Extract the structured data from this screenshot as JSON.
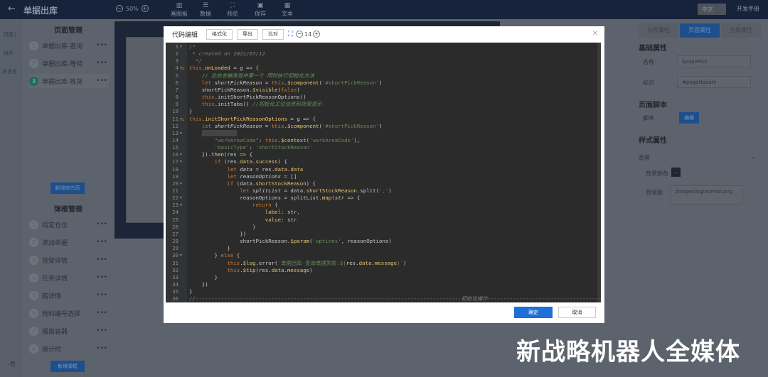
{
  "topbar": {
    "title": "单据出库",
    "zoom": "50%",
    "tools": [
      "画图板",
      "数据",
      "预览",
      "保存",
      "文本"
    ],
    "lang": "中文",
    "manual": "开发手册"
  },
  "rail": [
    "页面",
    "组件",
    "多语言"
  ],
  "sidebar": {
    "pages_title": "页面管理",
    "pages": [
      {
        "n": "1",
        "label": "单据出库-查询"
      },
      {
        "n": "2",
        "label": "单据出库-等待"
      },
      {
        "n": "3",
        "label": "单据出库-拣货"
      }
    ],
    "add_page": "新增空白页",
    "dialogs_title": "弹框管理",
    "dialogs": [
      {
        "n": "1",
        "label": "指定仓位"
      },
      {
        "n": "2",
        "label": "添加单据"
      },
      {
        "n": "3",
        "label": "货架详情"
      },
      {
        "n": "4",
        "label": "任务详情"
      },
      {
        "n": "5",
        "label": "箱详情"
      },
      {
        "n": "6",
        "label": "物料编号选择"
      },
      {
        "n": "7",
        "label": "搬离容器"
      },
      {
        "n": "8",
        "label": "倒计时"
      }
    ],
    "add_dialog": "新增弹框"
  },
  "right": {
    "tabs": [
      "元件属性",
      "页面属性",
      "全局属性"
    ],
    "basic": "基础属性",
    "name_label": "名称",
    "name_value": "$pagePick",
    "id_label": "标识",
    "id_value": "#pageUpdate",
    "script_title": "页面脚本",
    "script_label": "脚本",
    "edit": "编辑",
    "style_title": "样式属性",
    "bg": "背景",
    "bg_color": "背景颜色",
    "bg_img": "背景图",
    "bg_img_value": "/images/bg/normal.png"
  },
  "modal": {
    "title": "代码编辑",
    "format": "格式化",
    "export": "导出",
    "compare": "比对",
    "font_size": "14",
    "ok": "确定",
    "cancel": "取消",
    "lines": [
      {
        "f": 1,
        "t": [
          [
            "cz",
            "/*"
          ]
        ]
      },
      {
        "t": [
          [
            "cz",
            " * created on 2021/07/12"
          ]
        ]
      },
      {
        "t": [
          [
            "cz",
            "  */"
          ]
        ]
      },
      {
        "f": 1,
        "w": 1,
        "t": [
          [
            "kw",
            "this"
          ],
          [
            "",
            "."
          ],
          [
            "fn",
            "onLoaded"
          ],
          [
            "",
            " = g => {"
          ]
        ]
      },
      {
        "t": [
          [
            "cm",
            "    // 此处会触发选中第一个 同时执行初始化方法"
          ]
        ]
      },
      {
        "t": [
          [
            "kw",
            "    let "
          ],
          [
            "it",
            "shortPickReason"
          ],
          [
            "",
            " = "
          ],
          [
            "kw",
            "this"
          ],
          [
            "",
            "."
          ],
          [
            "pr",
            "$component"
          ],
          [
            "",
            "("
          ],
          [
            "st",
            "'#shortPickReason'"
          ],
          [
            "",
            ")"
          ]
        ]
      },
      {
        "t": [
          [
            "",
            "    shortPickReason."
          ],
          [
            "pr",
            "$visible"
          ],
          [
            "",
            "("
          ],
          [
            "kw",
            "false"
          ],
          [
            "",
            ")"
          ]
        ]
      },
      {
        "t": [
          [
            "kw",
            "    this"
          ],
          [
            "",
            ".initShortPickReasonOptions()"
          ]
        ]
      },
      {
        "t": [
          [
            "kw",
            "    this"
          ],
          [
            "",
            ".initTabs() "
          ],
          [
            "cm",
            "//初始化工位信息和货架显示"
          ]
        ]
      },
      {
        "t": [
          [
            "",
            "}"
          ]
        ]
      },
      {
        "f": 1,
        "w": 1,
        "t": [
          [
            "kw",
            "this"
          ],
          [
            "",
            "."
          ],
          [
            "fn",
            "initShortPickReasonOptions"
          ],
          [
            "",
            " = g => {"
          ]
        ]
      },
      {
        "t": [
          [
            "kw",
            "    let "
          ],
          [
            "it",
            "shortPickReason"
          ],
          [
            "",
            " = "
          ],
          [
            "kw",
            "this"
          ],
          [
            "",
            "."
          ],
          [
            "pr",
            "$component"
          ],
          [
            "",
            "("
          ],
          [
            "st",
            "'#shortPickReason'"
          ],
          [
            "",
            ")"
          ]
        ]
      },
      {
        "f": 1,
        "t": [
          [
            "",
            "    "
          ],
          [
            "bl",
            "           "
          ]
        ]
      },
      {
        "t": [
          [
            "st",
            "        \"workAreaCode\""
          ],
          [
            "",
            ": "
          ],
          [
            "kw",
            "this"
          ],
          [
            "",
            "."
          ],
          [
            "pr",
            "$context"
          ],
          [
            "",
            "("
          ],
          [
            "st",
            "'workAreaCode'"
          ],
          [
            "",
            "),"
          ]
        ]
      },
      {
        "t": [
          [
            "st",
            "        'basicType'"
          ],
          [
            "",
            ": "
          ],
          [
            "st",
            "'shortStockReason'"
          ]
        ]
      },
      {
        "f": 1,
        "t": [
          [
            "",
            "    })."
          ],
          [
            "fn",
            "then"
          ],
          [
            "",
            "(res => {"
          ]
        ]
      },
      {
        "f": 1,
        "t": [
          [
            "kw",
            "        if "
          ],
          [
            "",
            "(res."
          ],
          [
            "pr",
            "data"
          ],
          [
            "",
            "."
          ],
          [
            "pr",
            "success"
          ],
          [
            "",
            ") {"
          ]
        ]
      },
      {
        "t": [
          [
            "kw",
            "            let "
          ],
          [
            "it",
            "data"
          ],
          [
            "",
            " = res."
          ],
          [
            "pr",
            "data"
          ],
          [
            "",
            "."
          ],
          [
            "pr",
            "data"
          ]
        ]
      },
      {
        "t": [
          [
            "kw",
            "            let "
          ],
          [
            "it",
            "reasonOptions"
          ],
          [
            "",
            " = []"
          ]
        ]
      },
      {
        "f": 1,
        "t": [
          [
            "kw",
            "            if "
          ],
          [
            "",
            "(data."
          ],
          [
            "pr",
            "shortStockReason"
          ],
          [
            "",
            ") {"
          ]
        ]
      },
      {
        "t": [
          [
            "kw",
            "                let "
          ],
          [
            "it",
            "splitList"
          ],
          [
            "",
            " = data."
          ],
          [
            "pr",
            "shortStockReason"
          ],
          [
            "",
            ".split("
          ],
          [
            "st",
            "','"
          ],
          [
            "",
            ")"
          ]
        ]
      },
      {
        "f": 1,
        "t": [
          [
            "",
            "                reasonOptions = splitList."
          ],
          [
            "fn",
            "map"
          ],
          [
            "",
            "("
          ],
          [
            "it",
            "str"
          ],
          [
            "",
            " => {"
          ]
        ]
      },
      {
        "f": 1,
        "t": [
          [
            "kw",
            "                    return "
          ],
          [
            "",
            "{"
          ]
        ]
      },
      {
        "t": [
          [
            "pr",
            "                        label"
          ],
          [
            "",
            ": str,"
          ]
        ]
      },
      {
        "t": [
          [
            "pr",
            "                        value"
          ],
          [
            "",
            ": str"
          ]
        ]
      },
      {
        "t": [
          [
            "",
            "                    }"
          ]
        ]
      },
      {
        "t": [
          [
            "",
            "                })"
          ]
        ]
      },
      {
        "t": [
          [
            "",
            "                shortPickReason."
          ],
          [
            "pr",
            "$param"
          ],
          [
            "",
            "("
          ],
          [
            "st",
            "'options'"
          ],
          [
            "",
            ", reasonOptions)"
          ]
        ]
      },
      {
        "t": [
          [
            "",
            "            }"
          ]
        ]
      },
      {
        "f": 1,
        "t": [
          [
            "",
            "        } "
          ],
          [
            "kw",
            "else"
          ],
          [
            "",
            " {"
          ]
        ]
      },
      {
        "t": [
          [
            "kw",
            "            this"
          ],
          [
            "",
            "."
          ],
          [
            "pr",
            "$log"
          ],
          [
            "",
            ".error("
          ],
          [
            "st",
            "`单据出库-查询单据失败:${"
          ],
          [
            "",
            "res."
          ],
          [
            "pr",
            "data"
          ],
          [
            "",
            "."
          ],
          [
            "pr",
            "message"
          ],
          [
            "st",
            "}`"
          ],
          [
            "",
            ")"
          ]
        ]
      },
      {
        "t": [
          [
            "kw",
            "            this"
          ],
          [
            "",
            "."
          ],
          [
            "pr",
            "$tip"
          ],
          [
            "",
            "(res."
          ],
          [
            "pr",
            "data"
          ],
          [
            "",
            "."
          ],
          [
            "pr",
            "message"
          ],
          [
            "",
            ")"
          ]
        ]
      },
      {
        "t": [
          [
            "",
            "        }"
          ]
        ]
      },
      {
        "t": [
          [
            "",
            "    })"
          ]
        ]
      },
      {
        "t": [
          [
            "",
            "}"
          ]
        ]
      },
      {
        "t": [
          [
            "cz",
            "//------------------------------------------------------------------------------------初始化操作----------------------------------------------"
          ]
        ]
      }
    ]
  },
  "watermark": "新战略机器人全媒体"
}
